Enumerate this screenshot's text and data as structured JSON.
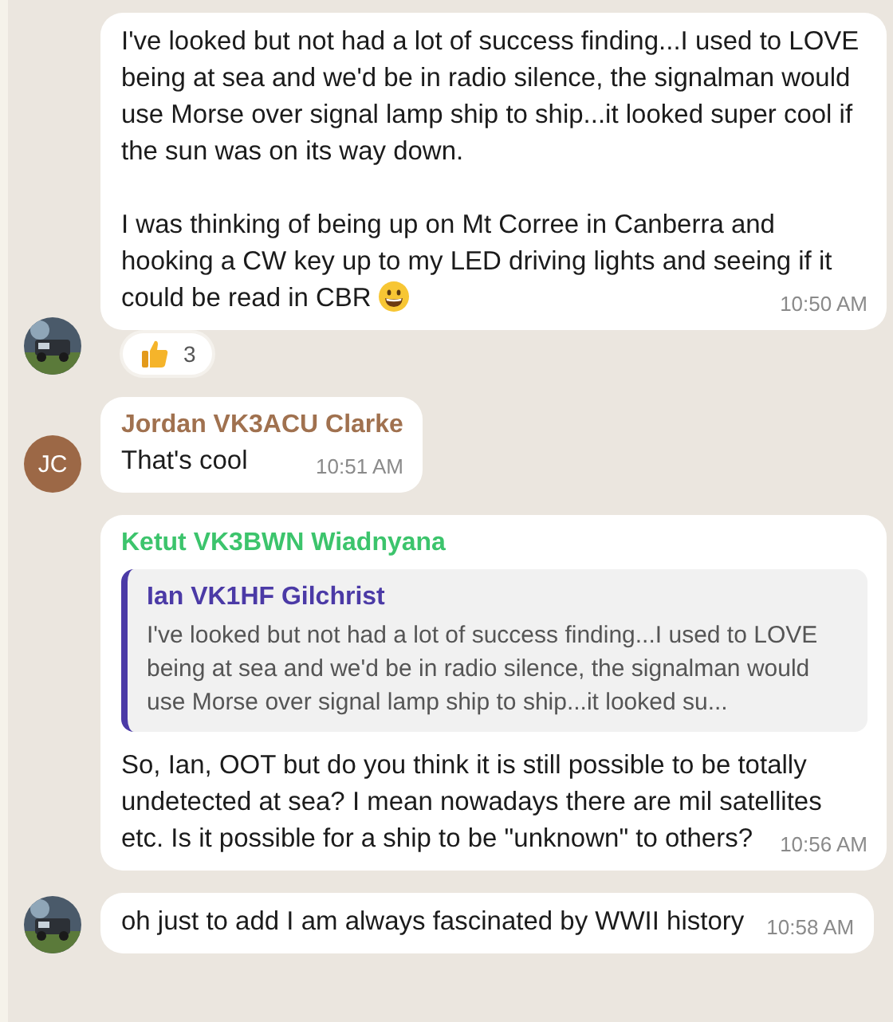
{
  "messages": [
    {
      "avatar": {
        "kind": "picture"
      },
      "paragraphs": [
        {
          "text": "I've looked but not had a lot of success finding...I used to LOVE being at sea and we'd be in radio silence, the signalman would use Morse over signal lamp ship to ship...it looked super cool if the sun was on its way down."
        },
        {
          "text": "I was thinking of being up on Mt Corree in Canberra and hooking a CW key up to my LED driving lights and seeing if it could be read in CBR",
          "kind": "with-grin"
        }
      ],
      "time": "10:50 AM",
      "reactions": [
        {
          "kind": "thumbs-up",
          "count": "3"
        }
      ]
    },
    {
      "avatar": {
        "kind": "initials",
        "text": "JC",
        "color": "#9c6846"
      },
      "sender": {
        "name": "Jordan VK3ACU Clarke",
        "color": "#a0714f"
      },
      "paragraphs": [
        {
          "text": "That's cool"
        }
      ],
      "time": "10:51 AM"
    },
    {
      "sender": {
        "name": "Ketut VK3BWN Wiadnyana",
        "color": "#3cc46c"
      },
      "quote": {
        "name": "Ian VK1HF Gilchrist",
        "color": "#4b3aa6",
        "text": "I've looked but not had a lot of success finding...I used to LOVE being at sea and we'd be in radio silence, the signalman would use Morse over signal lamp ship to ship...it looked su..."
      },
      "paragraphs": [
        {
          "text": "So, Ian, OOT but do you think it is still possible to be totally undetected at sea? I mean nowadays there are mil satellites etc. Is it possible for a ship to be \"unknown\" to others?"
        }
      ],
      "time": "10:56 AM"
    },
    {
      "avatar": {
        "kind": "picture"
      },
      "paragraphs": [
        {
          "text": "oh just to add I am always fascinated by WWII history"
        }
      ],
      "time": "10:58 AM"
    }
  ]
}
